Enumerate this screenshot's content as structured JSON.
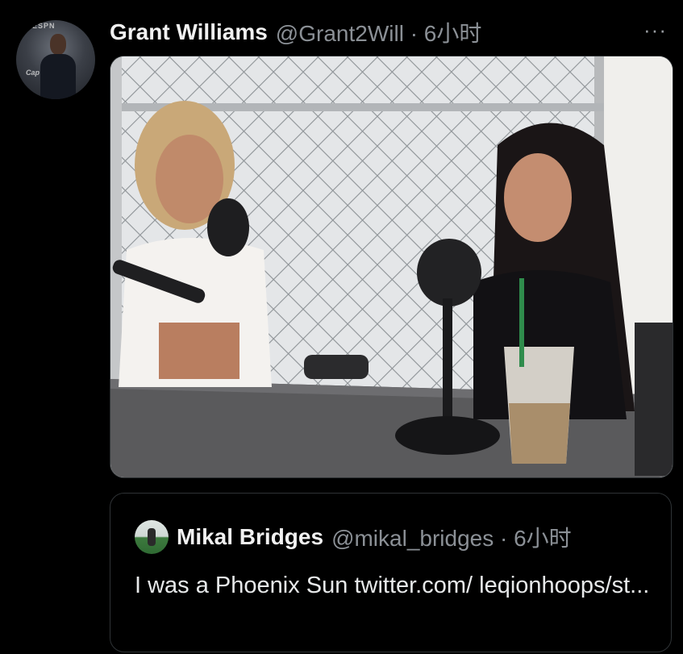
{
  "tweet": {
    "author_name": "Grant Williams",
    "author_meta": "@Grant2Will · 6小时",
    "more_label": "···",
    "avatar_logo_text": "ESPN",
    "avatar_cap_text": "Cap"
  },
  "quote": {
    "author_name": "Mikal Bridges",
    "author_meta": "@mikal_bridges · 6小时",
    "text": "I was a Phoenix Sun twitter.com/ leqionhoops/st..."
  },
  "colors": {
    "background": "#000000",
    "primary_text": "#e7e9ea",
    "secondary_text": "#8b9096",
    "border": "#2f3336"
  }
}
